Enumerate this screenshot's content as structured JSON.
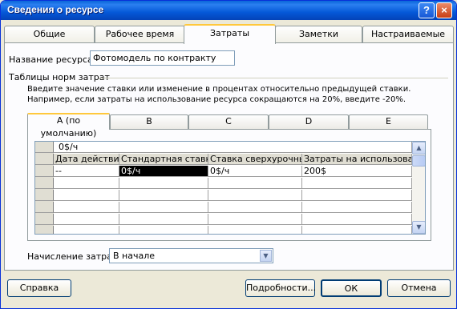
{
  "window": {
    "title": "Сведения о ресурсе",
    "help_glyph": "?",
    "close_glyph": "×"
  },
  "tabs": [
    {
      "label": "Общие"
    },
    {
      "label": "Рабочее время"
    },
    {
      "label": "Затраты"
    },
    {
      "label": "Заметки"
    },
    {
      "label": "Настраиваемые поля"
    }
  ],
  "active_tab": "Затраты",
  "resource_name": {
    "label": "Название ресурса:",
    "value": "Фотомодель по контракту"
  },
  "cost_rate_tables": {
    "group_label": "Таблицы норм затрат",
    "hint": "Введите значение ставки или изменение в процентах относительно предыдущей ставки. Например, если затраты на использование ресурса сокращаются на 20%, введите -20%.",
    "tabs": [
      {
        "label": "А (по умолчанию)"
      },
      {
        "label": "B"
      },
      {
        "label": "C"
      },
      {
        "label": "D"
      },
      {
        "label": "E"
      }
    ],
    "edit_value": "0$/ч",
    "columns": [
      "Дата действия",
      "Стандартная ставка",
      "Ставка сверхурочных",
      "Затраты на использование"
    ],
    "rows": [
      [
        "--",
        "0$/ч",
        "0$/ч",
        "200$"
      ],
      [
        "",
        "",
        "",
        ""
      ],
      [
        "",
        "",
        "",
        ""
      ],
      [
        "",
        "",
        "",
        ""
      ],
      [
        "",
        "",
        "",
        ""
      ],
      [
        "",
        "",
        "",
        ""
      ]
    ]
  },
  "cost_accrual": {
    "label": "Начисление затрат:",
    "value": "В начале"
  },
  "buttons": {
    "help": "Справка",
    "details": "Подробности...",
    "ok": "ОК",
    "cancel": "Отмена"
  },
  "colors": {
    "titlebar": "#0558d8",
    "tab_highlight": "#ffc83c",
    "face": "#ece9d8"
  }
}
